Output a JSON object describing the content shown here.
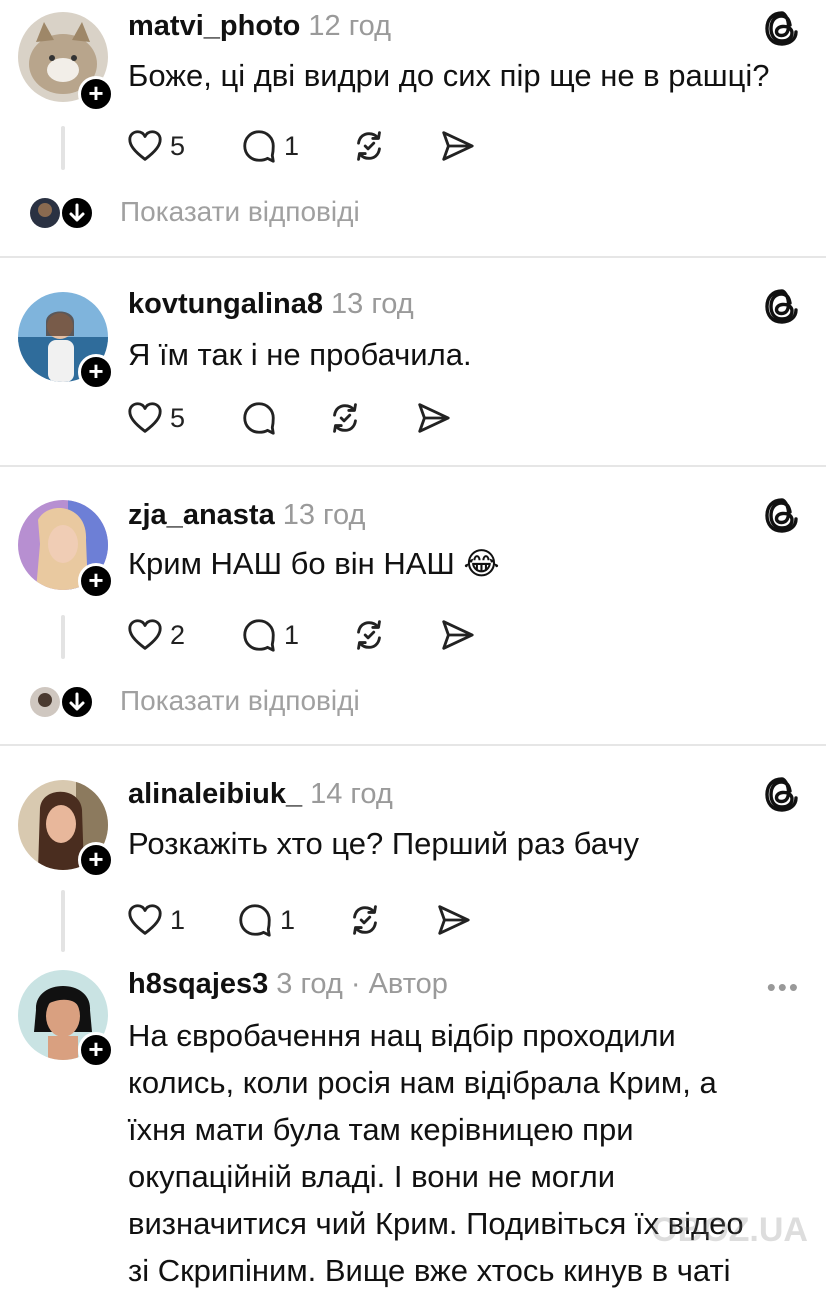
{
  "posts": [
    {
      "username": "matvi_photo",
      "time": "12 год",
      "text": "Боже, ці дві видри до сих пір ще не в рашці?",
      "likes": "5",
      "replies": "1",
      "show_replies": "Показати відповіді"
    },
    {
      "username": "kovtungalina8",
      "time": "13 год",
      "text": "Я їм так і не пробачила.",
      "likes": "5",
      "replies": ""
    },
    {
      "username": "zja_anasta",
      "time": "13 год",
      "text": "Крим НАШ бо він НАШ 😂",
      "likes": "2",
      "replies": "1",
      "show_replies": "Показати відповіді"
    },
    {
      "username": "alinaleibiuk_",
      "time": "14 год",
      "text": "Розкажіть хто це? Перший раз бачу",
      "likes": "1",
      "replies": "1"
    },
    {
      "username": "h8sqajes3",
      "time": "3 год · Автор",
      "text_lines": [
        "На євробачення нац відбір проходили",
        "колись, коли росія нам відібрала Крим, а",
        "їхня мати була там керівницею при",
        "окупаційній владі. І вони не могли",
        "визначитися чий Крим. Подивіться їх відео",
        "зі Скрипіним. Вище вже хтось кинув в чаті"
      ]
    }
  ],
  "more_label": "•••",
  "icons": [
    "threads-icon",
    "heart-icon",
    "comment-icon",
    "repost-icon",
    "share-icon",
    "chevron-down-icon",
    "follow-plus-icon"
  ],
  "watermark": "OBOZ.UA",
  "colors": {
    "muted": "#9a9a9a",
    "divider": "#e6e6e6",
    "thread": "#e3e3e3"
  }
}
